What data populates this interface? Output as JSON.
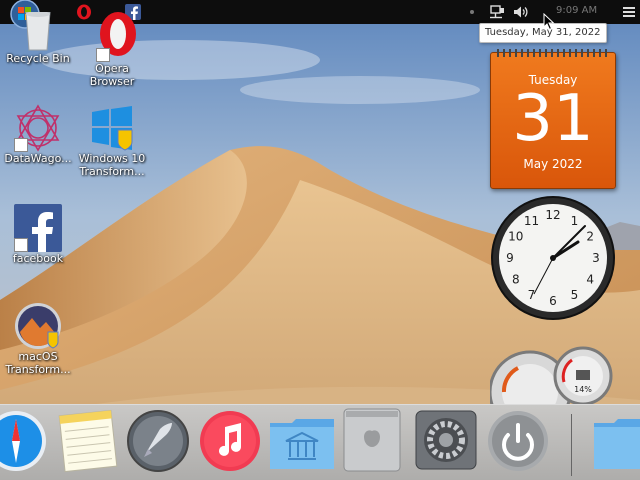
{
  "topbar": {
    "clock_text": "9:09 AM",
    "start_icon": "windows-start-icon",
    "pinned": [
      "opera-icon",
      "facebook-icon"
    ],
    "tray": [
      "network-icon",
      "volume-icon",
      "menu-icon"
    ]
  },
  "tooltip": {
    "text": "Tuesday, May 31, 2022"
  },
  "desktop_icons": [
    {
      "label": "Recycle Bin",
      "icon": "recycle-bin-icon"
    },
    {
      "label": "Opera Browser",
      "icon": "opera-icon"
    },
    {
      "label": "DataWago...",
      "icon": "datawago-icon"
    },
    {
      "label": "Windows 10 Transform...",
      "icon": "windows10-transform-icon"
    },
    {
      "label": "facebook",
      "icon": "facebook-icon"
    },
    {
      "label": "macOS Transform...",
      "icon": "macos-transform-icon"
    }
  ],
  "calendar": {
    "weekday": "Tuesday",
    "day": "31",
    "month_year": "May 2022"
  },
  "clock_widget": {
    "numerals": [
      "12",
      "1",
      "2",
      "3",
      "4",
      "5",
      "6",
      "7",
      "8",
      "9",
      "10",
      "11"
    ]
  },
  "meters": {
    "battery_label": "14%"
  },
  "dock": {
    "items": [
      "safari-icon",
      "notes-icon",
      "launchpad-icon",
      "itunes-icon",
      "folder-icon",
      "mac-pro-icon",
      "system-preferences-icon",
      "power-icon",
      "folder-icon"
    ]
  },
  "colors": {
    "topbar": "#0d0d0d",
    "calendar": "#e8671a",
    "dock": "#bdbcba"
  }
}
